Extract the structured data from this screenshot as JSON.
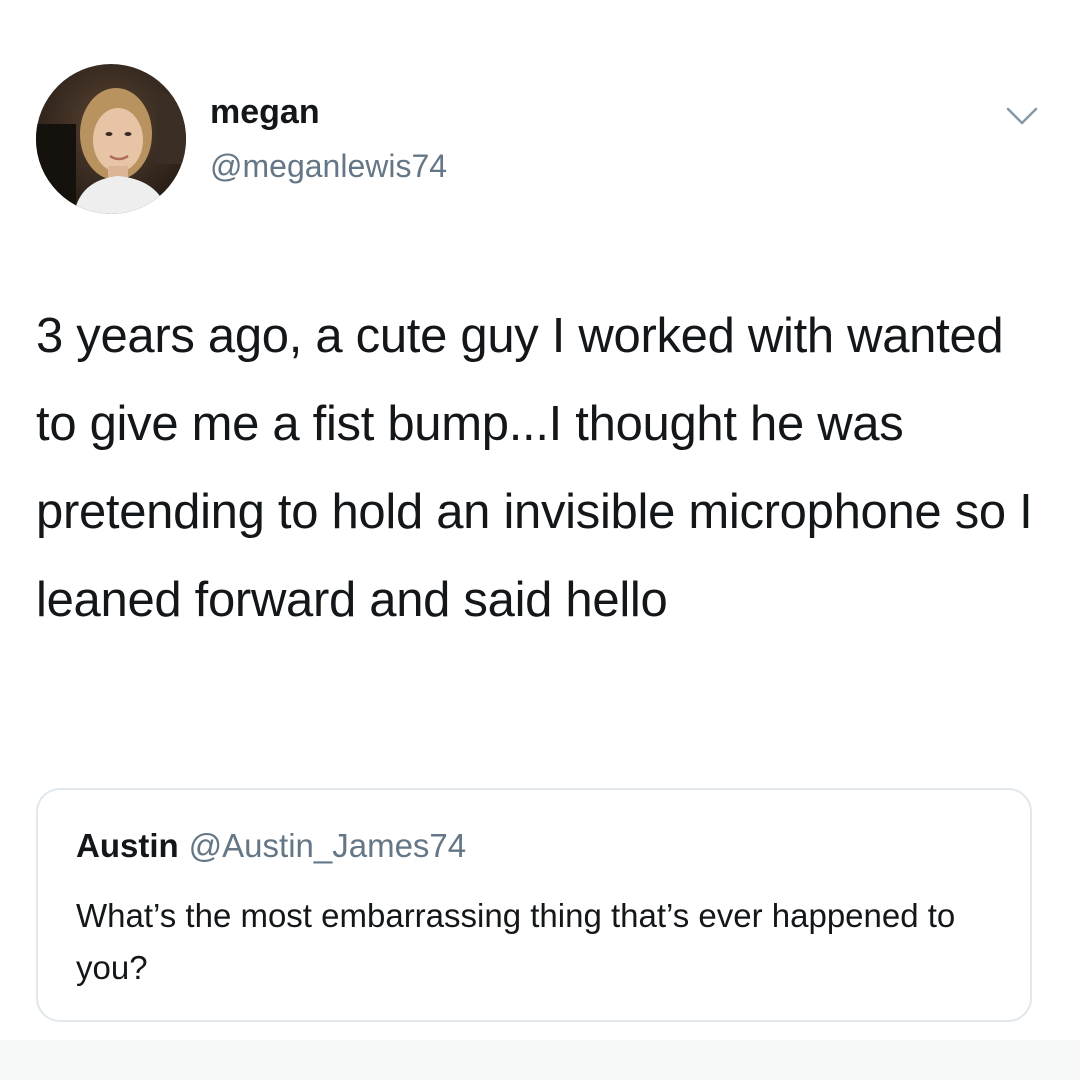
{
  "tweet": {
    "author": {
      "display_name": "megan",
      "handle": "@meganlewis74",
      "avatar_icon": "profile-photo"
    },
    "menu_icon": "chevron-down-icon",
    "text": "3 years ago, a cute guy I worked with wanted to give me a fist bump...I thought he was pretending to hold an invisible microphone so I leaned forward and said hello",
    "quoted_tweet": {
      "display_name": "Austin",
      "handle": "@Austin_James74",
      "text": "What’s the most embarrassing thing that’s ever happened to you?"
    }
  },
  "colors": {
    "text_primary": "#14171a",
    "text_secondary": "#657786",
    "border": "#e1e8ed",
    "background": "#ffffff"
  }
}
